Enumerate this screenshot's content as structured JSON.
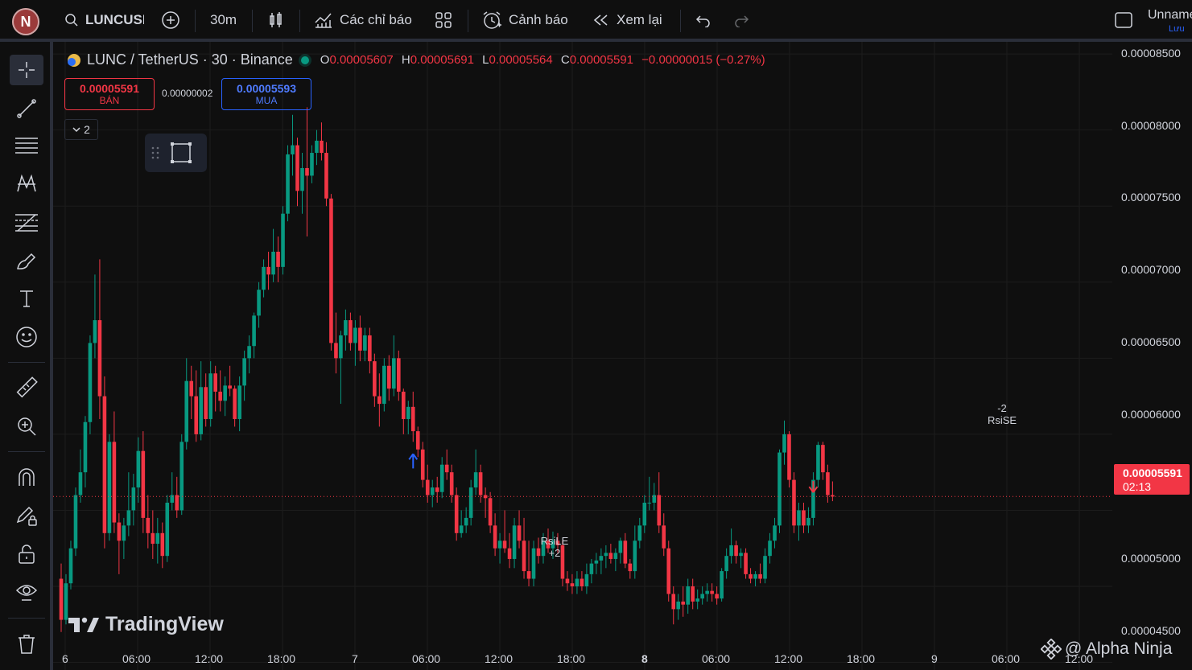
{
  "toolbar": {
    "avatar_letter": "N",
    "symbol": "LUNCUSD",
    "interval": "30m",
    "indicators_label": "Các chỉ báo",
    "alerts_label": "Cảnh báo",
    "replay_label": "Xem lại",
    "layout_name": "Unnamed",
    "saved_label": "Lưu"
  },
  "legend": {
    "title": "LUNC / TetherUS · 30 · Binance",
    "o_key": "O",
    "o_val": "0.00005607",
    "h_key": "H",
    "h_val": "0.00005691",
    "l_key": "L",
    "l_val": "0.00005564",
    "c_key": "C",
    "c_val": "0.00005591",
    "change": "−0.00000015 (−0.27%)",
    "sell_price": "0.00005591",
    "sell_label": "BÁN",
    "spread": "0.00000002",
    "buy_price": "0.00005593",
    "buy_label": "MUA",
    "collapse_count": "2"
  },
  "price_axis": {
    "labels": [
      "0.00008500",
      "0.00008000",
      "0.00007500",
      "0.00007000",
      "0.00006500",
      "0.00006000",
      "0.00005000",
      "0.00004500"
    ],
    "current_price": "0.00005591",
    "countdown": "02:13"
  },
  "time_axis": {
    "labels": [
      "6",
      "06:00",
      "12:00",
      "18:00",
      "7",
      "06:00",
      "12:00",
      "18:00",
      "8",
      "06:00",
      "12:00",
      "18:00",
      "9",
      "06:00",
      "12:00"
    ]
  },
  "signals": {
    "long_name": "RsiLE",
    "long_qty": "+2",
    "short_name": "RsiSE",
    "short_qty": "-2"
  },
  "watermark": "TradingView",
  "credit": "@ Alpha Ninja",
  "colors": {
    "up": "#089981",
    "down": "#f23645",
    "bg": "#0f0f0f",
    "grid": "#1c1c1c",
    "accent": "#2962ff"
  },
  "chart_data": {
    "type": "candlestick",
    "symbol": "LUNC / TetherUS",
    "interval": "30",
    "exchange": "Binance",
    "ylim": [
      4.45e-05,
      8.58e-05
    ],
    "current_price": 5.591e-05,
    "candles": [
      [
        5.05e-05,
        5.15e-05,
        4.7e-05,
        4.78e-05
      ],
      [
        4.78e-05,
        5.08e-05,
        4.75e-05,
        5.02e-05
      ],
      [
        5.02e-05,
        5.3e-05,
        4.98e-05,
        5.25e-05
      ],
      [
        5.25e-05,
        5.65e-05,
        5.2e-05,
        5.6e-05
      ],
      [
        5.6e-05,
        5.9e-05,
        5.55e-05,
        5.75e-05
      ],
      [
        5.75e-05,
        6.12e-05,
        5.65e-05,
        6.08e-05
      ],
      [
        6.08e-05,
        6.65e-05,
        6e-05,
        6.6e-05
      ],
      [
        6.6e-05,
        7.05e-05,
        6.5e-05,
        6.75e-05
      ],
      [
        6.75e-05,
        7.15e-05,
        6.1e-05,
        6.25e-05
      ],
      [
        6.25e-05,
        6.38e-05,
        5.25e-05,
        5.35e-05
      ],
      [
        5.35e-05,
        6e-05,
        5.3e-05,
        5.95e-05
      ],
      [
        5.95e-05,
        6.15e-05,
        5.35e-05,
        5.42e-05
      ],
      [
        5.42e-05,
        5.48e-05,
        5.08e-05,
        5.3e-05
      ],
      [
        5.3e-05,
        5.45e-05,
        5.18e-05,
        5.4e-05
      ],
      [
        5.4e-05,
        5.75e-05,
        5.33e-05,
        5.5e-05
      ],
      [
        5.5e-05,
        5.74e-05,
        5.4e-05,
        5.65e-05
      ],
      [
        5.65e-05,
        5.98e-05,
        5.55e-05,
        5.89e-05
      ],
      [
        5.89e-05,
        6.02e-05,
        5.35e-05,
        5.45e-05
      ],
      [
        5.45e-05,
        5.6e-05,
        5.25e-05,
        5.35e-05
      ],
      [
        5.35e-05,
        5.5e-05,
        5.18e-05,
        5.28e-05
      ],
      [
        5.28e-05,
        5.45e-05,
        5.15e-05,
        5.35e-05
      ],
      [
        5.35e-05,
        5.42e-05,
        5.12e-05,
        5.2e-05
      ],
      [
        5.2e-05,
        5.6e-05,
        5.16e-05,
        5.55e-05
      ],
      [
        5.55e-05,
        5.75e-05,
        5.5e-05,
        5.6e-05
      ],
      [
        5.6e-05,
        5.72e-05,
        5.45e-05,
        5.5e-05
      ],
      [
        5.5e-05,
        6e-05,
        5.47e-05,
        5.95e-05
      ],
      [
        5.95e-05,
        6.5e-05,
        5.9e-05,
        6.35e-05
      ],
      [
        6.35e-05,
        6.45e-05,
        6.1e-05,
        6.25e-05
      ],
      [
        6.25e-05,
        6.42e-05,
        5.95e-05,
        6e-05
      ],
      [
        6e-05,
        6.48e-05,
        5.96e-05,
        6.31e-05
      ],
      [
        6.31e-05,
        6.4e-05,
        6.05e-05,
        6.1e-05
      ],
      [
        6.1e-05,
        6.48e-05,
        6.05e-05,
        6.4e-05
      ],
      [
        6.4e-05,
        6.45e-05,
        6.15e-05,
        6.28e-05
      ],
      [
        6.28e-05,
        6.42e-05,
        6.15e-05,
        6.22e-05
      ],
      [
        6.22e-05,
        6.38e-05,
        6.12e-05,
        6.32e-05
      ],
      [
        6.32e-05,
        6.45e-05,
        6.25e-05,
        6.3e-05
      ],
      [
        6.3e-05,
        6.32e-05,
        6.05e-05,
        6.1e-05
      ],
      [
        6.1e-05,
        6.38e-05,
        6.02e-05,
        6.32e-05
      ],
      [
        6.32e-05,
        6.55e-05,
        6.22e-05,
        6.5e-05
      ],
      [
        6.5e-05,
        6.65e-05,
        6.4e-05,
        6.58e-05
      ],
      [
        6.58e-05,
        6.8e-05,
        6.5e-05,
        6.78e-05
      ],
      [
        6.78e-05,
        7e-05,
        6.7e-05,
        6.95e-05
      ],
      [
        6.95e-05,
        7.15e-05,
        6.9e-05,
        7.1e-05
      ],
      [
        7.1e-05,
        7.2e-05,
        6.95e-05,
        7.05e-05
      ],
      [
        7.05e-05,
        7.35e-05,
        7e-05,
        7.2e-05
      ],
      [
        7.2e-05,
        7.3e-05,
        7e-05,
        7.1e-05
      ],
      [
        7.1e-05,
        7.5e-05,
        7.05e-05,
        7.45e-05
      ],
      [
        7.45e-05,
        7.9e-05,
        7.4e-05,
        7.84e-05
      ],
      [
        7.84e-05,
        8.1e-05,
        7.7e-05,
        7.9e-05
      ],
      [
        7.9e-05,
        7.95e-05,
        7.5e-05,
        7.6e-05
      ],
      [
        7.6e-05,
        7.85e-05,
        7.45e-05,
        7.75e-05
      ],
      [
        7.75e-05,
        8.15e-05,
        7.3e-05,
        7.7e-05
      ],
      [
        7.7e-05,
        7.9e-05,
        7.65e-05,
        7.85e-05
      ],
      [
        7.85e-05,
        8e-05,
        7.77e-05,
        7.93e-05
      ],
      [
        7.93e-05,
        8.05e-05,
        7.8e-05,
        7.85e-05
      ],
      [
        7.85e-05,
        7.92e-05,
        7.5e-05,
        7.55e-05
      ],
      [
        7.55e-05,
        7.58e-05,
        6.55e-05,
        6.6e-05
      ],
      [
        6.6e-05,
        6.8e-05,
        6.4e-05,
        6.5e-05
      ],
      [
        6.5e-05,
        6.68e-05,
        6.2e-05,
        6.65e-05
      ],
      [
        6.65e-05,
        6.82e-05,
        6.55e-05,
        6.75e-05
      ],
      [
        6.75e-05,
        6.8e-05,
        6.55e-05,
        6.6e-05
      ],
      [
        6.6e-05,
        6.75e-05,
        6.45e-05,
        6.7e-05
      ],
      [
        6.7e-05,
        6.78e-05,
        6.48e-05,
        6.55e-05
      ],
      [
        6.55e-05,
        6.7e-05,
        6.48e-05,
        6.65e-05
      ],
      [
        6.65e-05,
        6.7e-05,
        6.4e-05,
        6.48e-05
      ],
      [
        6.48e-05,
        6.53e-05,
        6.18e-05,
        6.25e-05
      ],
      [
        6.25e-05,
        6.4e-05,
        6.05e-05,
        6.2e-05
      ],
      [
        6.2e-05,
        6.5e-05,
        6.15e-05,
        6.45e-05
      ],
      [
        6.45e-05,
        6.52e-05,
        6.22e-05,
        6.3e-05
      ],
      [
        6.3e-05,
        6.65e-05,
        6.25e-05,
        6.5e-05
      ],
      [
        6.5e-05,
        6.55e-05,
        6.22e-05,
        6.28e-05
      ],
      [
        6.28e-05,
        6.3e-05,
        6e-05,
        6.1e-05
      ],
      [
        6.1e-05,
        6.22e-05,
        6e-05,
        6.18e-05
      ],
      [
        6.18e-05,
        6.28e-05,
        5.95e-05,
        6.02e-05
      ],
      [
        6.02e-05,
        6.05e-05,
        5.85e-05,
        5.9e-05
      ],
      [
        5.9e-05,
        5.95e-05,
        5.65e-05,
        5.7e-05
      ],
      [
        5.7e-05,
        5.8e-05,
        5.55e-05,
        5.6e-05
      ],
      [
        5.6e-05,
        5.7e-05,
        5.52e-05,
        5.65e-05
      ],
      [
        5.65e-05,
        5.72e-05,
        5.55e-05,
        5.62e-05
      ],
      [
        5.62e-05,
        5.85e-05,
        5.58e-05,
        5.8e-05
      ],
      [
        5.8e-05,
        5.9e-05,
        5.7e-05,
        5.75e-05
      ],
      [
        5.75e-05,
        5.8e-05,
        5.55e-05,
        5.6e-05
      ],
      [
        5.6e-05,
        5.65e-05,
        5.3e-05,
        5.35e-05
      ],
      [
        5.35e-05,
        5.5e-05,
        5.32e-05,
        5.4e-05
      ],
      [
        5.4e-05,
        5.52e-05,
        5.35e-05,
        5.45e-05
      ],
      [
        5.45e-05,
        5.7e-05,
        5.4e-05,
        5.65e-05
      ],
      [
        5.65e-05,
        5.9e-05,
        5.6e-05,
        5.75e-05
      ],
      [
        5.75e-05,
        5.8e-05,
        5.55e-05,
        5.6e-05
      ],
      [
        5.6e-05,
        5.65e-05,
        5.45e-05,
        5.58e-05
      ],
      [
        5.58e-05,
        5.62e-05,
        5.35e-05,
        5.4e-05
      ],
      [
        5.4e-05,
        5.48e-05,
        5.2e-05,
        5.25e-05
      ],
      [
        5.25e-05,
        5.35e-05,
        5.15e-05,
        5.3e-05
      ],
      [
        5.3e-05,
        5.5e-05,
        5.22e-05,
        5.25e-05
      ],
      [
        5.25e-05,
        5.35e-05,
        5.12e-05,
        5.18e-05
      ],
      [
        5.18e-05,
        5.45e-05,
        5.12e-05,
        5.4e-05
      ],
      [
        5.4e-05,
        5.5e-05,
        5.25e-05,
        5.3e-05
      ],
      [
        5.3e-05,
        5.45e-05,
        5.05e-05,
        5.1e-05
      ],
      [
        5.1e-05,
        5.3e-05,
        5e-05,
        5.05e-05
      ],
      [
        5.05e-05,
        5.3e-05,
        5e-05,
        5.25e-05
      ],
      [
        5.25e-05,
        5.32e-05,
        5.15e-05,
        5.2e-05
      ],
      [
        5.2e-05,
        5.35e-05,
        5.15e-05,
        5.3e-05
      ],
      [
        5.3e-05,
        5.38e-05,
        5.22e-05,
        5.25e-05
      ],
      [
        5.25e-05,
        5.36e-05,
        5.18e-05,
        5.3e-05
      ],
      [
        5.3e-05,
        5.35e-05,
        5.22e-05,
        5.27e-05
      ],
      [
        5.27e-05,
        5.3e-05,
        5e-05,
        5.05e-05
      ],
      [
        5.05e-05,
        5.1e-05,
        4.97e-05,
        5.02e-05
      ],
      [
        5.02e-05,
        5.08e-05,
        4.95e-05,
        5e-05
      ],
      [
        5e-05,
        5.1e-05,
        4.95e-05,
        5.05e-05
      ],
      [
        5.05e-05,
        5.1e-05,
        4.97e-05,
        5e-05
      ],
      [
        5e-05,
        5.15e-05,
        4.95e-05,
        5.08e-05
      ],
      [
        5.08e-05,
        5.18e-05,
        5.02e-05,
        5.15e-05
      ],
      [
        5.15e-05,
        5.22e-05,
        5.08e-05,
        5.17e-05
      ],
      [
        5.17e-05,
        5.25e-05,
        5.08e-05,
        5.2e-05
      ],
      [
        5.2e-05,
        5.27e-05,
        5.12e-05,
        5.22e-05
      ],
      [
        5.22e-05,
        5.28e-05,
        5.15e-05,
        5.18e-05
      ],
      [
        5.18e-05,
        5.25e-05,
        5.1e-05,
        5.22e-05
      ],
      [
        5.22e-05,
        5.32e-05,
        5.15e-05,
        5.3e-05
      ],
      [
        5.3e-05,
        5.35e-05,
        5.12e-05,
        5.15e-05
      ],
      [
        5.15e-05,
        5.18e-05,
        5.05e-05,
        5.1e-05
      ],
      [
        5.1e-05,
        5.4e-05,
        5.05e-05,
        5.3e-05
      ],
      [
        5.3e-05,
        5.45e-05,
        5.25e-05,
        5.4e-05
      ],
      [
        5.4e-05,
        5.6e-05,
        5.35e-05,
        5.55e-05
      ],
      [
        5.55e-05,
        5.72e-05,
        5.5e-05,
        5.55e-05
      ],
      [
        5.55e-05,
        5.68e-05,
        5.5e-05,
        5.6e-05
      ],
      [
        5.6e-05,
        5.75e-05,
        5.35e-05,
        5.4e-05
      ],
      [
        5.4e-05,
        5.48e-05,
        5.2e-05,
        5.25e-05
      ],
      [
        5.25e-05,
        5.3e-05,
        4.9e-05,
        4.95e-05
      ],
      [
        4.95e-05,
        5e-05,
        4.75e-05,
        4.85e-05
      ],
      [
        4.85e-05,
        4.95e-05,
        4.78e-05,
        4.9e-05
      ],
      [
        4.9e-05,
        5e-05,
        4.8e-05,
        4.88e-05
      ],
      [
        4.88e-05,
        5.05e-05,
        4.82e-05,
        5e-05
      ],
      [
        5e-05,
        5.05e-05,
        4.85e-05,
        4.9e-05
      ],
      [
        4.9e-05,
        4.98e-05,
        4.85e-05,
        4.92e-05
      ],
      [
        4.92e-05,
        5e-05,
        4.88e-05,
        4.95e-05
      ],
      [
        4.95e-05,
        5.02e-05,
        4.9e-05,
        4.97e-05
      ],
      [
        4.97e-05,
        5.02e-05,
        4.9e-05,
        4.95e-05
      ],
      [
        4.95e-05,
        5e-05,
        4.88e-05,
        4.92e-05
      ],
      [
        4.92e-05,
        5.12e-05,
        4.9e-05,
        5.1e-05
      ],
      [
        5.1e-05,
        5.25e-05,
        5.05e-05,
        5.2e-05
      ],
      [
        5.2e-05,
        5.38e-05,
        5.15e-05,
        5.27e-05
      ],
      [
        5.27e-05,
        5.3e-05,
        5.15e-05,
        5.2e-05
      ],
      [
        5.2e-05,
        5.25e-05,
        5.12e-05,
        5.22e-05
      ],
      [
        5.22e-05,
        5.25e-05,
        5.05e-05,
        5.08e-05
      ],
      [
        5.08e-05,
        5.12e-05,
        5.02e-05,
        5.05e-05
      ],
      [
        5.05e-05,
        5.1e-05,
        5e-05,
        5.08e-05
      ],
      [
        5.08e-05,
        5.15e-05,
        5.02e-05,
        5.05e-05
      ],
      [
        5.05e-05,
        5.25e-05,
        5.02e-05,
        5.2e-05
      ],
      [
        5.2e-05,
        5.35e-05,
        5.15e-05,
        5.3e-05
      ],
      [
        5.3e-05,
        5.45e-05,
        5.25e-05,
        5.4e-05
      ],
      [
        5.4e-05,
        5.9e-05,
        5.35e-05,
        5.88e-05
      ],
      [
        5.88e-05,
        6.09e-05,
        5.8e-05,
        6e-05
      ],
      [
        6e-05,
        6.02e-05,
        5.65e-05,
        5.7e-05
      ],
      [
        5.7e-05,
        5.75e-05,
        5.35e-05,
        5.4e-05
      ],
      [
        5.4e-05,
        5.55e-05,
        5.3e-05,
        5.5e-05
      ],
      [
        5.5e-05,
        5.55e-05,
        5.35e-05,
        5.4e-05
      ],
      [
        5.4e-05,
        5.52e-05,
        5.35e-05,
        5.45e-05
      ],
      [
        5.45e-05,
        5.75e-05,
        5.4e-05,
        5.7e-05
      ],
      [
        5.7e-05,
        5.95e-05,
        5.65e-05,
        5.93e-05
      ],
      [
        5.93e-05,
        5.95e-05,
        5.7e-05,
        5.75e-05
      ],
      [
        5.75e-05,
        5.8e-05,
        5.55e-05,
        5.6e-05
      ],
      [
        5.6e-05,
        5.69e-05,
        5.56e-05,
        5.59e-05
      ]
    ],
    "signals": [
      {
        "name": "RsiLE",
        "qty": "+2",
        "side": "long",
        "bar_index": 73
      },
      {
        "name": "RsiSE",
        "qty": "-2",
        "side": "short",
        "bar_index": 156
      }
    ]
  }
}
